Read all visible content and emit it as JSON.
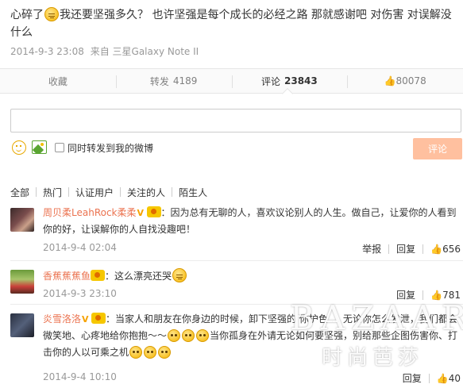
{
  "post": {
    "text_1": "心碎了",
    "text_2": "我还要坚强多久？ 也许坚强是每个成长的必经之路 那就感谢吧 对伤害 对误解没什么",
    "time": "2014-9-3 23:08",
    "source": "来自 三星Galaxy Note II"
  },
  "actions": {
    "favorite": "收藏",
    "repost_label": "转发",
    "repost_count": "4189",
    "comment_label": "评论",
    "comment_count": "23843",
    "like_count": "80078"
  },
  "composer": {
    "input_value": "",
    "also_repost_label": "同时转发到我的微博",
    "submit_label": "评论"
  },
  "filters": [
    "全部",
    "热门",
    "认证用户",
    "关注的人",
    "陌生人"
  ],
  "comments": [
    {
      "user": "周贝柔LeahRock柔柔",
      "text": "：因为总有无聊的人，喜欢议论别人的人生。做自己，让爱你的人看到你的好，让误解你的人自找没趣吧！",
      "time": "2014-9-4 02:04",
      "report": "举报",
      "reply": "回复",
      "likes": "656"
    },
    {
      "user": "香蕉蕉蕉鱼",
      "text": "：这么漂亮还哭",
      "time": "2014-9-3 23:10",
      "reply": "回复",
      "likes": "781"
    },
    {
      "user": "炎雪洛洛",
      "text_1": "：当家人和朋友在你身边的时候，卸下坚强的 你护色 ... 无论你怎么发泄，我们都会微笑地、心疼地给你抱抱～～",
      "text_2": "当你孤身在外请无论如何要坚强，别给那些企图伤害你、打击你的人以可乘之机",
      "time": "2014-9-4 10:10",
      "reply": "回复",
      "likes": "40"
    }
  ],
  "watermark": {
    "top": "BAZAAR",
    "bottom": "时尚芭莎"
  }
}
